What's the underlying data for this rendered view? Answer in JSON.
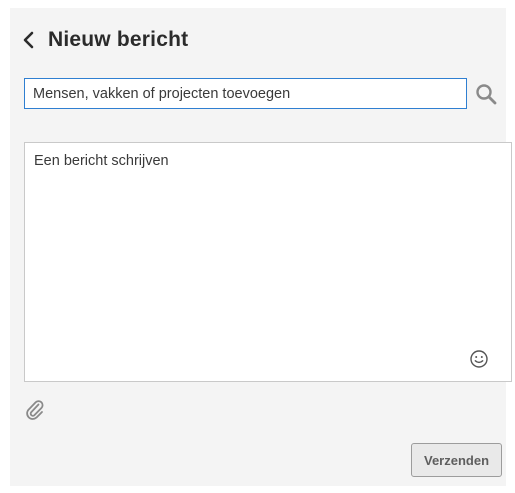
{
  "header": {
    "title": "Nieuw bericht",
    "back_icon": "chevron-left-icon"
  },
  "recipients": {
    "placeholder": "Mensen, vakken of projecten toevoegen",
    "value": "",
    "search_icon": "search-icon"
  },
  "message": {
    "placeholder": "Een bericht schrijven",
    "value": "",
    "emoji_icon": "smiley-icon"
  },
  "attachment": {
    "icon": "paperclip-icon"
  },
  "actions": {
    "send_label": "Verzenden",
    "send_enabled": false
  },
  "colors": {
    "panel_background": "#f4f4f4",
    "focus_border": "#2f7fd1",
    "title_text": "#2b2b2b",
    "icon_grey": "#8a8a8a"
  }
}
